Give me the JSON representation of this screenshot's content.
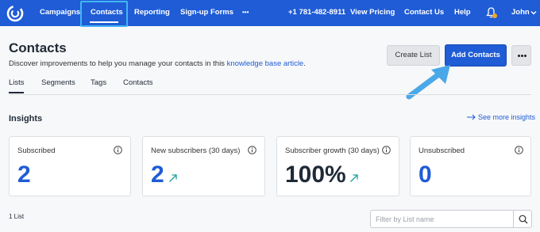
{
  "nav": {
    "items": [
      {
        "label": "Campaigns"
      },
      {
        "label": "Contacts",
        "active": true
      },
      {
        "label": "Reporting"
      },
      {
        "label": "Sign-up Forms"
      },
      {
        "label": "•••"
      }
    ],
    "phone": "+1 781-482-8911",
    "view_pricing": "View Pricing",
    "contact_us": "Contact Us",
    "help": "Help",
    "user": "John",
    "brand_color": "#1f5cd6",
    "highlight_color": "#42b4f5"
  },
  "header": {
    "title": "Contacts",
    "description_prefix": "Discover improvements to help you manage your contacts in this ",
    "description_link": "knowledge base article",
    "description_suffix": ".",
    "create_list": "Create List",
    "add_contacts": "Add Contacts"
  },
  "tabs": [
    {
      "label": "Lists",
      "active": true
    },
    {
      "label": "Segments"
    },
    {
      "label": "Tags"
    },
    {
      "label": "Contacts"
    }
  ],
  "insights": {
    "title": "Insights",
    "see_more": "See more insights",
    "cards": [
      {
        "label": "Subscribed",
        "value": "2",
        "trend": false
      },
      {
        "label": "New subscribers (30 days)",
        "value": "2",
        "trend": true
      },
      {
        "label": "Subscriber growth (30 days)",
        "value": "100%",
        "trend": true
      },
      {
        "label": "Unsubscribed",
        "value": "0",
        "trend": false
      }
    ]
  },
  "lists": {
    "count": "1 List",
    "filter_placeholder": "Filter by List name"
  }
}
